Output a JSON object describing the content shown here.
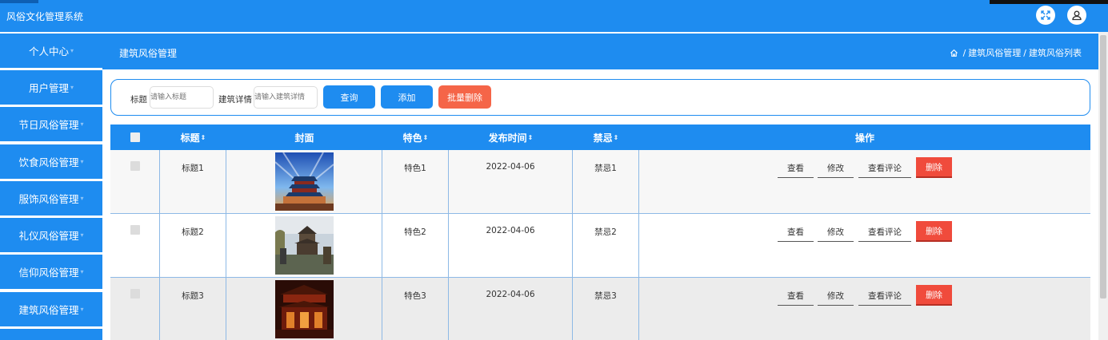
{
  "app": {
    "title": "风俗文化管理系统"
  },
  "top_actions": {
    "fullscreen_icon": "fullscreen-icon",
    "user_icon": "user-icon"
  },
  "sidebar": {
    "items": [
      {
        "label": "个人中心"
      },
      {
        "label": "用户管理"
      },
      {
        "label": "节日风俗管理"
      },
      {
        "label": "饮食风俗管理"
      },
      {
        "label": "服饰风俗管理"
      },
      {
        "label": "礼仪风俗管理"
      },
      {
        "label": "信仰风俗管理"
      },
      {
        "label": "建筑风俗管理"
      }
    ]
  },
  "header": {
    "title": "建筑风俗管理",
    "breadcrumb": {
      "home_icon": "home-icon",
      "level1": "建筑风俗管理",
      "level2": "建筑风俗列表",
      "separator": "/"
    }
  },
  "search": {
    "title_label": "标题",
    "title_placeholder": "请输入标题",
    "detail_label": "建筑详情",
    "detail_placeholder": "请输入建筑详情",
    "query_button": "查询",
    "add_button": "添加",
    "batch_delete_button": "批量删除"
  },
  "table": {
    "columns": [
      "标题",
      "封面",
      "特色",
      "发布时间",
      "禁忌",
      "操作"
    ],
    "sort_glyph": "⇕",
    "rows": [
      {
        "title": "标题1",
        "feature": "特色1",
        "date": "2022-04-06",
        "taboo": "禁忌1"
      },
      {
        "title": "标题2",
        "feature": "特色2",
        "date": "2022-04-06",
        "taboo": "禁忌2"
      },
      {
        "title": "标题3",
        "feature": "特色3",
        "date": "2022-04-06",
        "taboo": "禁忌3"
      }
    ],
    "actions": {
      "view": "查看",
      "edit": "修改",
      "comments": "查看评论",
      "delete": "删除"
    }
  },
  "colors": {
    "primary": "#1e8cf0",
    "danger": "#f04b3c",
    "batch_delete": "#f56548"
  }
}
